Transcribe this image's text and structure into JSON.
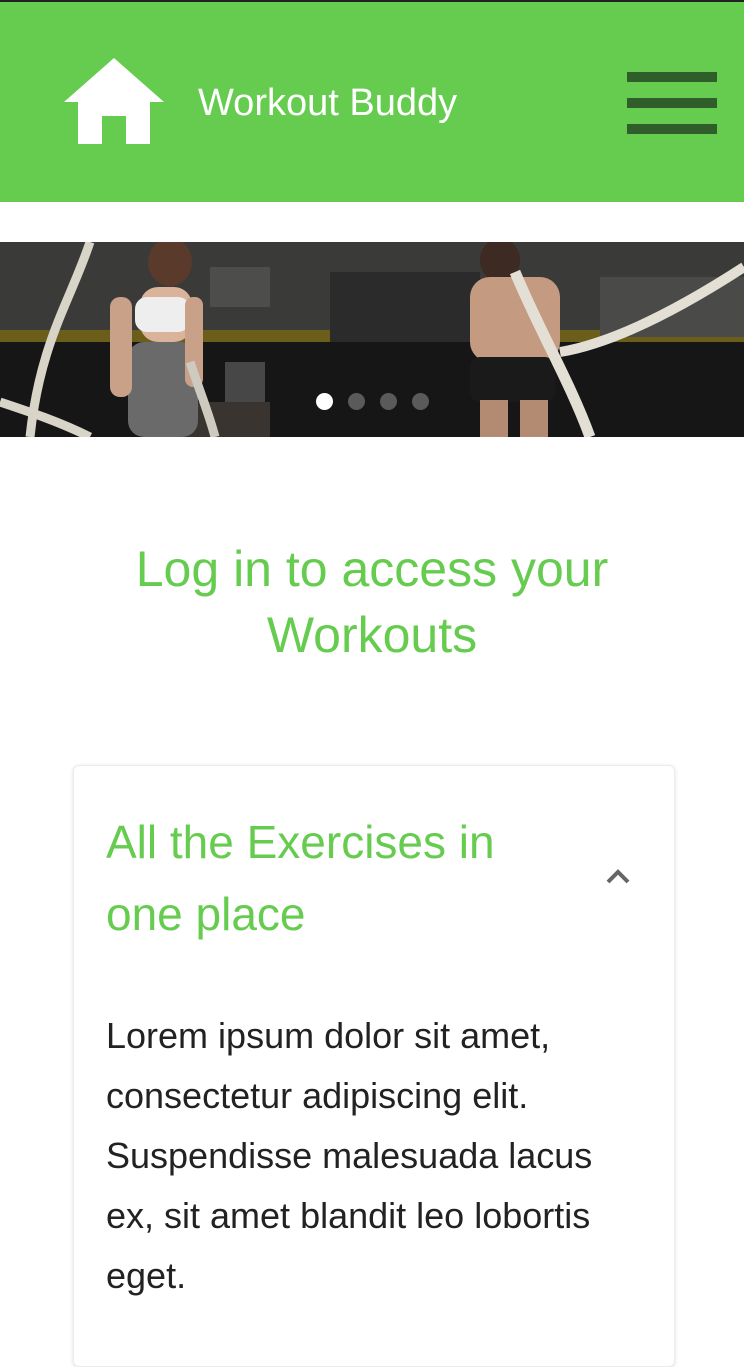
{
  "navbar": {
    "brand": "Workout Buddy",
    "home_icon": "home-icon",
    "menu_icon": "hamburger-menu-icon",
    "background_color": "#66cc4f"
  },
  "carousel": {
    "slide_count": 4,
    "active_index": 0
  },
  "headline": "Log in to access your Workouts",
  "card": {
    "title": "All the Exercises in one place",
    "toggle_icon": "chevron-up-icon",
    "body": "Lorem ipsum dolor sit amet, consectetur adipiscing elit. Suspendisse malesuada lacus ex, sit amet blandit leo lobortis eget."
  },
  "colors": {
    "accent": "#66cc4f",
    "menu_bars": "#2f5e2a",
    "body_text": "#222222"
  }
}
